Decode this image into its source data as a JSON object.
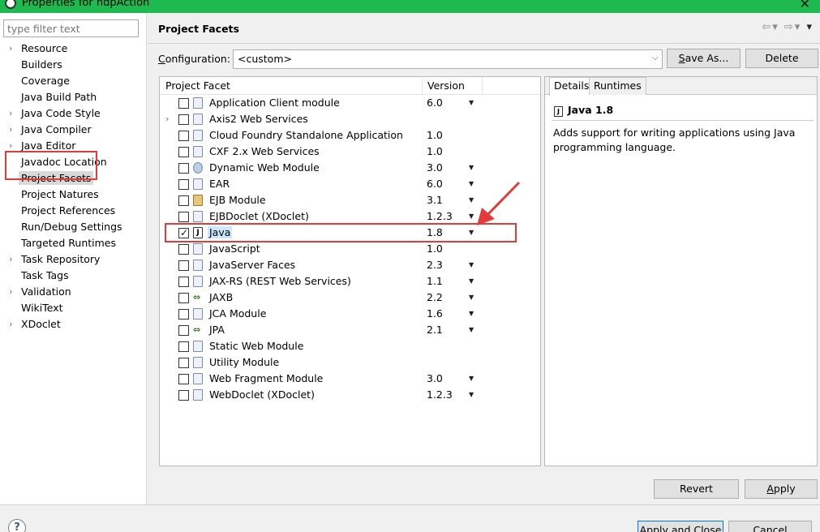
{
  "window": {
    "title": "Properties for hdpAction"
  },
  "filter": {
    "placeholder": "type filter text"
  },
  "tree": [
    {
      "label": "Resource",
      "expandable": true,
      "selected": false
    },
    {
      "label": "Builders",
      "expandable": false,
      "selected": false
    },
    {
      "label": "Coverage",
      "expandable": false,
      "selected": false
    },
    {
      "label": "Java Build Path",
      "expandable": false,
      "selected": false
    },
    {
      "label": "Java Code Style",
      "expandable": true,
      "selected": false
    },
    {
      "label": "Java Compiler",
      "expandable": true,
      "selected": false
    },
    {
      "label": "Java Editor",
      "expandable": true,
      "selected": false
    },
    {
      "label": "Javadoc Location",
      "expandable": false,
      "selected": false
    },
    {
      "label": "Project Facets",
      "expandable": false,
      "selected": true
    },
    {
      "label": "Project Natures",
      "expandable": false,
      "selected": false
    },
    {
      "label": "Project References",
      "expandable": false,
      "selected": false
    },
    {
      "label": "Run/Debug Settings",
      "expandable": false,
      "selected": false
    },
    {
      "label": "Targeted Runtimes",
      "expandable": false,
      "selected": false
    },
    {
      "label": "Task Repository",
      "expandable": true,
      "selected": false
    },
    {
      "label": "Task Tags",
      "expandable": false,
      "selected": false
    },
    {
      "label": "Validation",
      "expandable": true,
      "selected": false
    },
    {
      "label": "WikiText",
      "expandable": false,
      "selected": false
    },
    {
      "label": "XDoclet",
      "expandable": true,
      "selected": false
    }
  ],
  "header": {
    "title": "Project Facets"
  },
  "config": {
    "label_pre": "",
    "label_ul": "C",
    "label_post": "onfiguration:",
    "value": "<custom>",
    "save_as_ul": "S",
    "save_as_post": "ave As...",
    "delete_label": "Delete"
  },
  "table": {
    "col_facet": "Project Facet",
    "col_version": "Version"
  },
  "facets": [
    {
      "name": "Application Client module",
      "version": "6.0",
      "dropdown": true,
      "checked": false,
      "icon": "page",
      "expandable": false,
      "selected": false
    },
    {
      "name": "Axis2 Web Services",
      "version": "",
      "dropdown": false,
      "checked": false,
      "icon": "page",
      "expandable": true,
      "selected": false
    },
    {
      "name": "Cloud Foundry Standalone Application",
      "version": "1.0",
      "dropdown": false,
      "checked": false,
      "icon": "page",
      "expandable": false,
      "selected": false
    },
    {
      "name": "CXF 2.x Web Services",
      "version": "1.0",
      "dropdown": false,
      "checked": false,
      "icon": "page",
      "expandable": false,
      "selected": false
    },
    {
      "name": "Dynamic Web Module",
      "version": "3.0",
      "dropdown": true,
      "checked": false,
      "icon": "globe",
      "expandable": false,
      "selected": false
    },
    {
      "name": "EAR",
      "version": "6.0",
      "dropdown": true,
      "checked": false,
      "icon": "page",
      "expandable": false,
      "selected": false
    },
    {
      "name": "EJB Module",
      "version": "3.1",
      "dropdown": true,
      "checked": false,
      "icon": "bean",
      "expandable": false,
      "selected": false
    },
    {
      "name": "EJBDoclet (XDoclet)",
      "version": "1.2.3",
      "dropdown": true,
      "checked": false,
      "icon": "page",
      "expandable": false,
      "selected": false
    },
    {
      "name": "Java",
      "version": "1.8",
      "dropdown": true,
      "checked": true,
      "icon": "java",
      "expandable": false,
      "selected": true
    },
    {
      "name": "JavaScript",
      "version": "1.0",
      "dropdown": false,
      "checked": false,
      "icon": "page",
      "expandable": false,
      "selected": false
    },
    {
      "name": "JavaServer Faces",
      "version": "2.3",
      "dropdown": true,
      "checked": false,
      "icon": "page",
      "expandable": false,
      "selected": false
    },
    {
      "name": "JAX-RS (REST Web Services)",
      "version": "1.1",
      "dropdown": true,
      "checked": false,
      "icon": "page",
      "expandable": false,
      "selected": false
    },
    {
      "name": "JAXB",
      "version": "2.2",
      "dropdown": true,
      "checked": false,
      "icon": "xml",
      "expandable": false,
      "selected": false
    },
    {
      "name": "JCA Module",
      "version": "1.6",
      "dropdown": true,
      "checked": false,
      "icon": "page",
      "expandable": false,
      "selected": false
    },
    {
      "name": "JPA",
      "version": "2.1",
      "dropdown": true,
      "checked": false,
      "icon": "xml",
      "expandable": false,
      "selected": false
    },
    {
      "name": "Static Web Module",
      "version": "",
      "dropdown": false,
      "checked": false,
      "icon": "page",
      "expandable": false,
      "selected": false
    },
    {
      "name": "Utility Module",
      "version": "",
      "dropdown": false,
      "checked": false,
      "icon": "page",
      "expandable": false,
      "selected": false
    },
    {
      "name": "Web Fragment Module",
      "version": "3.0",
      "dropdown": true,
      "checked": false,
      "icon": "page",
      "expandable": false,
      "selected": false
    },
    {
      "name": "WebDoclet (XDoclet)",
      "version": "1.2.3",
      "dropdown": true,
      "checked": false,
      "icon": "page",
      "expandable": false,
      "selected": false
    }
  ],
  "details": {
    "tab_details": "Details",
    "tab_runtimes": "Runtimes",
    "title": "Java 1.8",
    "description": "Adds support for writing applications using Java programming language."
  },
  "buttons": {
    "revert": "Revert",
    "apply_ul": "A",
    "apply_post": "pply",
    "apply_close": "Apply and Close",
    "cancel": "Cancel"
  },
  "colors": {
    "annotation_red": "#e33a3a",
    "titlebar_green": "#1fba4f",
    "selection_blue": "#cce8ff"
  }
}
